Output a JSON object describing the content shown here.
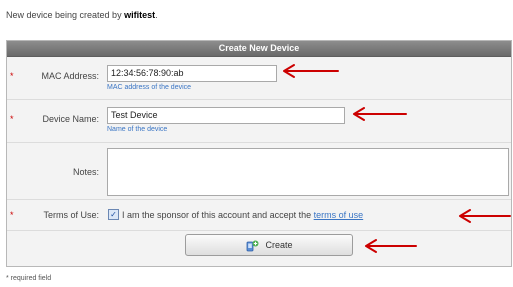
{
  "intro": {
    "prefix": "New device being created by",
    "user": "wifitest"
  },
  "panel": {
    "title": "Create New Device"
  },
  "fields": {
    "mac": {
      "label": "MAC Address:",
      "value": "12:34:56:78:90:ab",
      "hint": "MAC address of the device"
    },
    "name": {
      "label": "Device Name:",
      "value": "Test Device",
      "hint": "Name of the device"
    },
    "notes": {
      "label": "Notes:"
    },
    "terms": {
      "label": "Terms of Use:",
      "text": "I am the sponsor of this account and accept the",
      "link": "terms of use"
    }
  },
  "required_marker": "*",
  "button": {
    "label": "Create",
    "icon": "device-create-icon"
  },
  "footnote": "* required field",
  "colors": {
    "header": "#7a7a7a",
    "link": "#3a75c4",
    "arrow": "#cc0000",
    "required": "#cc0000"
  }
}
